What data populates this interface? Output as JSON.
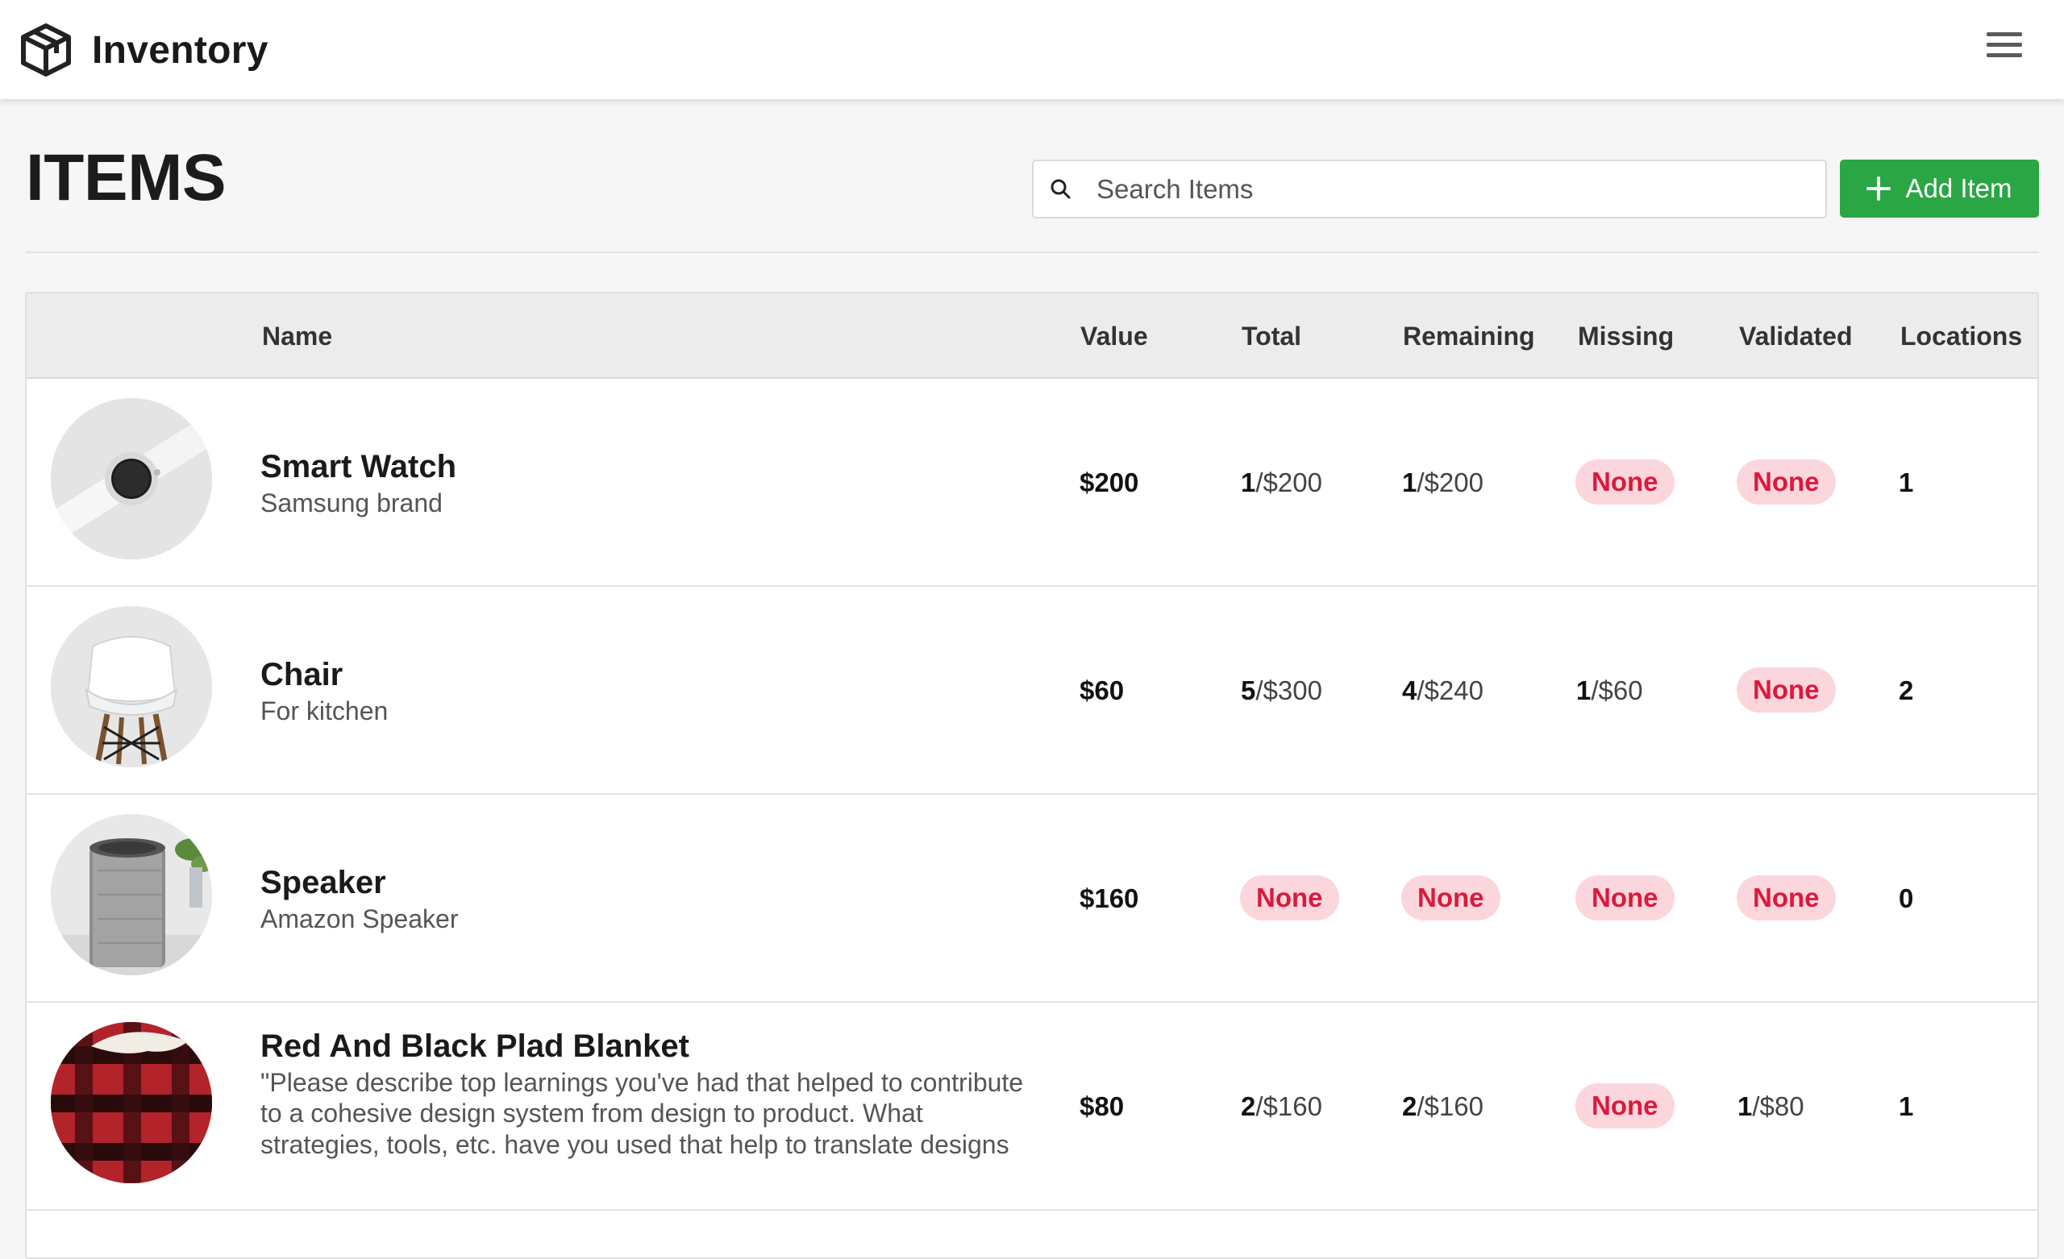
{
  "app": {
    "name": "Inventory",
    "logo_icon": "box-icon",
    "menu_icon": "hamburger-menu-icon"
  },
  "page": {
    "title": "ITEMS"
  },
  "search": {
    "placeholder": "Search Items",
    "value": ""
  },
  "add_button": {
    "label": "Add Item",
    "color": "#2aa644"
  },
  "colors": {
    "badge_bg": "#fcd6dd",
    "badge_text": "#d91a3c"
  },
  "table": {
    "columns": [
      "Name",
      "Value",
      "Total",
      "Remaining",
      "Missing",
      "Validated",
      "Locations"
    ],
    "rows": [
      {
        "image": "smart-watch-image",
        "name": "Smart Watch",
        "description": "Samsung brand",
        "value": "$200",
        "total": {
          "count": "1",
          "amount": "/$200"
        },
        "remaining": {
          "count": "1",
          "amount": "/$200"
        },
        "missing": "None",
        "validated": "None",
        "locations": "1"
      },
      {
        "image": "chair-image",
        "name": "Chair",
        "description": "For kitchen",
        "value": "$60",
        "total": {
          "count": "5",
          "amount": "/$300"
        },
        "remaining": {
          "count": "4",
          "amount": "/$240"
        },
        "missing": {
          "count": "1",
          "amount": "/$60"
        },
        "validated": "None",
        "locations": "2"
      },
      {
        "image": "speaker-image",
        "name": "Speaker",
        "description": "Amazon Speaker",
        "value": "$160",
        "total": "None",
        "remaining": "None",
        "missing": "None",
        "validated": "None",
        "locations": "0"
      },
      {
        "image": "blanket-image",
        "name": "Red And Black Plad Blanket",
        "description": "\"Please describe top learnings you've had that helped to contribute to a cohesive design system from design to product. What strategies, tools, etc. have you used that help to translate designs",
        "value": "$80",
        "total": {
          "count": "2",
          "amount": "/$160"
        },
        "remaining": {
          "count": "2",
          "amount": "/$160"
        },
        "missing": "None",
        "validated": {
          "count": "1",
          "amount": "/$80"
        },
        "locations": "1"
      }
    ]
  }
}
